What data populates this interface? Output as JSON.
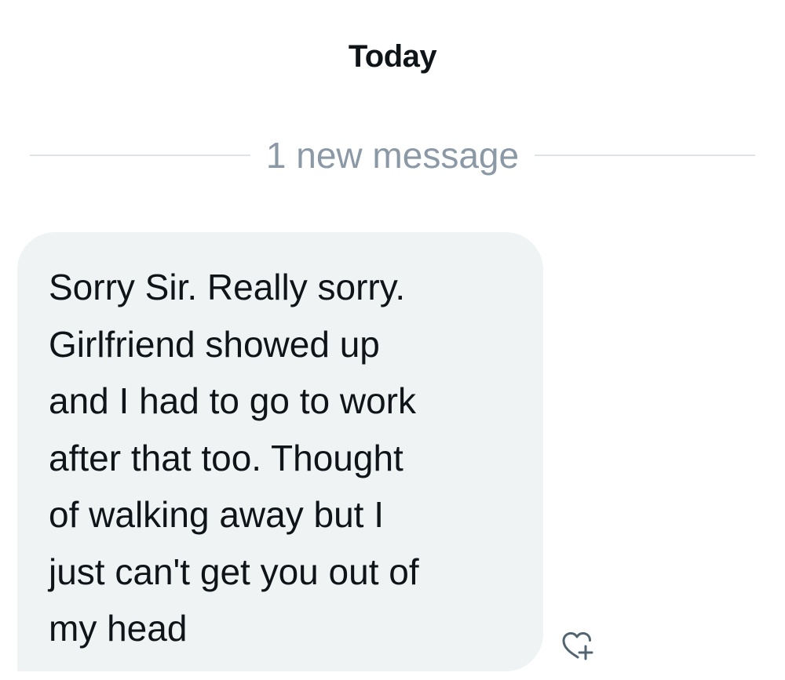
{
  "conversation": {
    "date_header": "Today",
    "new_messages_divider": "1 new message",
    "messages": [
      {
        "direction": "received",
        "text": "Sorry Sir. Really sorry.\nGirlfriend showed up\nand I had to go to work\nafter that too. Thought\nof walking away but I\njust can't get you out of\nmy head",
        "reaction_icon": "heart-plus-icon"
      }
    ]
  },
  "colors": {
    "bubble_background": "#eff3f4",
    "primary_text": "#0f1419",
    "secondary_text": "#8b98a5",
    "divider": "#dfe4e8"
  }
}
